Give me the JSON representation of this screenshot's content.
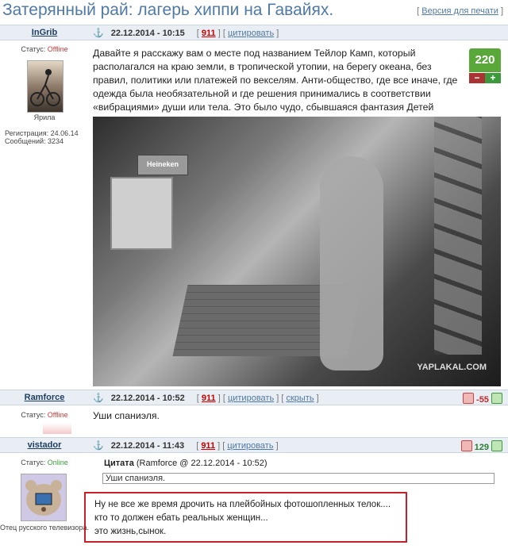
{
  "page": {
    "title": "Затерянный рай: лагерь хиппи на Гавайях.",
    "print_version": {
      "bracket_open": "[",
      "label": "Версия для печати",
      "bracket_close": "]"
    }
  },
  "posts": [
    {
      "author": "InGrib",
      "status_label": "Статус:",
      "status": "Offline",
      "avatar_caption": "Ярила",
      "registration": "Регистрация: 24.06.14",
      "messages": "Сообщений: 3234",
      "anchor": "⚓",
      "date": "22.12.2014 - 10:15",
      "post_number": "911",
      "quote_link": "цитировать",
      "rating": "220",
      "rating_minus": "−",
      "rating_plus": "+",
      "text": "Давайте я расскажу вам о месте под названием Тейлор Камп, который располагался на краю земли, в тропической утопии, на берегу океана, без правил, политики или платежей по векселям. Анти-общество, где все иначе, где одежда была необязательной и где решения принимались в соответствии «вибрациями» души или тела. Это было чудо, сбывшаяся фантазия Детей Цветов.",
      "image_label": "Heineken",
      "watermark": "YAPLAKAL.COM"
    },
    {
      "author": "Ramforce",
      "status_label": "Статус:",
      "status": "Offline",
      "anchor": "⚓",
      "date": "22.12.2014 - 10:52",
      "post_number": "911",
      "quote_link": "цитировать",
      "hide_link": "скрыть",
      "rating": "-55",
      "text": "Уши спаниэля."
    },
    {
      "author": "vistador",
      "status_label": "Статус:",
      "status": "Online",
      "avatar_caption": "Отец русского телевизора.",
      "anchor": "⚓",
      "date": "22.12.2014 - 11:43",
      "post_number": "911",
      "quote_link": "цитировать",
      "rating": "129",
      "quote_title": "Цитата",
      "quote_source": "(Ramforce @ 22.12.2014 - 10:52)",
      "quote_text": "Уши спаниэля.",
      "lines": [
        "Ну не все же время дрочить на плейбойных фотошопленных телок....",
        "кто то должен ебать реальных женщин...",
        "это жизнь,сынок."
      ]
    }
  ],
  "colors": {
    "header_bg": "#e8eef4",
    "link": "#4f79a6",
    "accent_red": "#c71f2b",
    "rating_green": "#5aa73a"
  }
}
